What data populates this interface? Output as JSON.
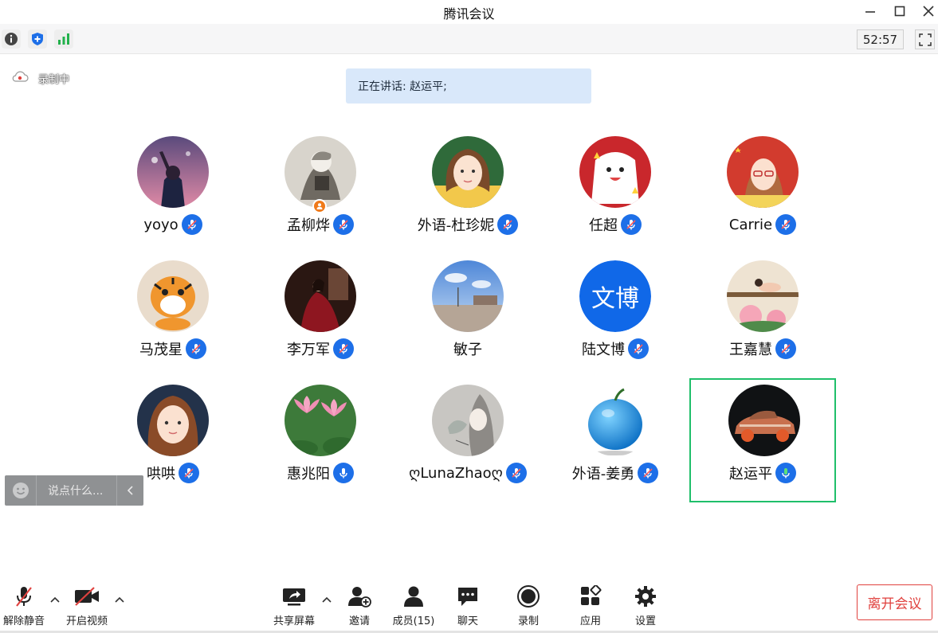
{
  "window": {
    "title": "腾讯会议"
  },
  "toolbar": {
    "timer": "52:57"
  },
  "recording": {
    "label": "录制中"
  },
  "speaking": {
    "text": "正在讲话: 赵运平;"
  },
  "participants": [
    {
      "name": "yoyo"
    },
    {
      "name": "孟柳烨"
    },
    {
      "name": "外语-杜珍妮"
    },
    {
      "name": "任超"
    },
    {
      "name": "Carrie"
    },
    {
      "name": "马茂星"
    },
    {
      "name": "李万军"
    },
    {
      "name": "敏子"
    },
    {
      "name": "陆文博",
      "avatar_text": "文博"
    },
    {
      "name": "王嘉慧"
    },
    {
      "name": "哄哄"
    },
    {
      "name": "惠兆阳"
    },
    {
      "name": "ღLunaZhaoღ"
    },
    {
      "name": "外语-姜勇"
    },
    {
      "name": "赵运平"
    }
  ],
  "chat": {
    "placeholder": "说点什么..."
  },
  "bottom": {
    "unmute": "解除静音",
    "start_video": "开启视频",
    "share_screen": "共享屏幕",
    "invite": "邀请",
    "members": "成员(15)",
    "chat": "聊天",
    "record": "录制",
    "apps": "应用",
    "settings": "设置",
    "leave": "离开会议"
  },
  "colors": {
    "accent": "#1d6fe8",
    "active_speaker_border": "#1fbf6a",
    "leave": "#e0413e",
    "speaking_banner": "#d9e8fa"
  }
}
